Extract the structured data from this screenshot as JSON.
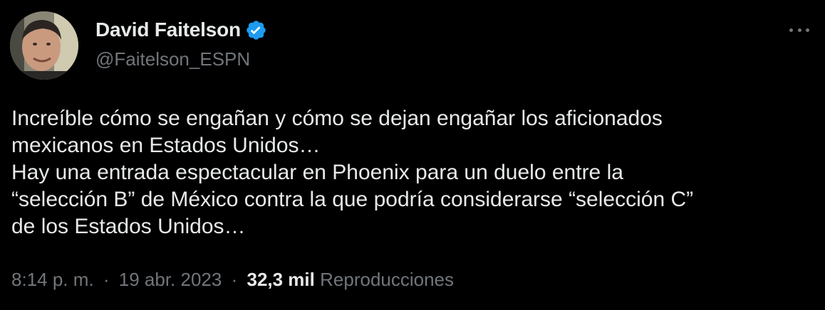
{
  "author": {
    "display_name": "David Faitelson",
    "handle": "@Faitelson_ESPN",
    "verified_icon": "verified-badge-icon",
    "avatar_icon": "profile-photo"
  },
  "menu": {
    "icon": "more-options-icon"
  },
  "tweet": {
    "lines": [
      "Increíble cómo se engañan y cómo se dejan engañar los aficionados",
      "mexicanos en Estados Unidos…",
      "Hay una entrada espectacular en Phoenix para un duelo entre la",
      "“selección B” de México contra la que podría considerarse “selección C”",
      "de los Estados Unidos…"
    ]
  },
  "meta": {
    "time": "8:14 p. m.",
    "separator": "·",
    "date": "19 abr. 2023",
    "views_count": "32,3 mil",
    "views_label": "Reproducciones"
  },
  "colors": {
    "background": "#000000",
    "primary_text": "#e7e9ea",
    "secondary_text": "#71767b",
    "verified_blue": "#1d9bf0"
  }
}
